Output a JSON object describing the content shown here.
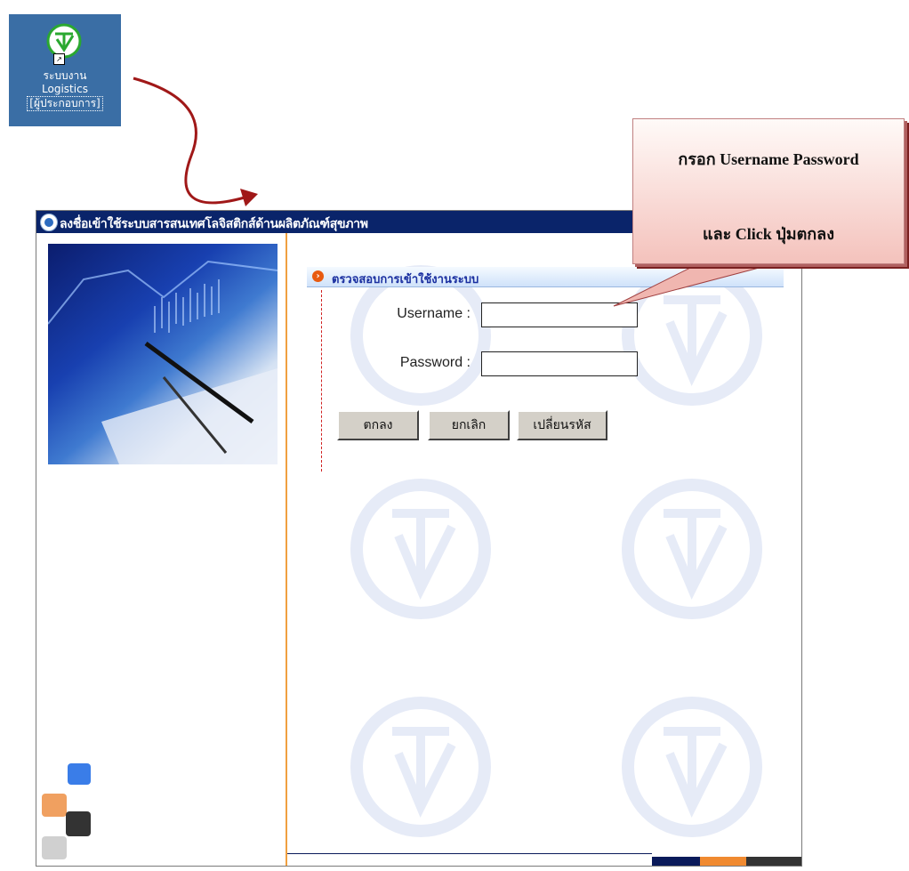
{
  "desktop_icon": {
    "label_lines": [
      "ระบบงาน",
      "Logistics",
      "[ผู้ประกอบการ]"
    ]
  },
  "window": {
    "title": "ลงชื่อเข้าใช้ระบบสารสนเทศโลจิสติกส์ด้านผลิตภัณฑ์สุขภาพ",
    "section_header": "ตรวจสอบการเข้าใช้งานระบบ",
    "username_label": "Username :",
    "username_value": "",
    "password_label": "Password :",
    "password_value": "",
    "buttons": {
      "ok": "ตกลง",
      "cancel": "ยกเลิก",
      "change_password": "เปลี่ยนรหัส"
    }
  },
  "callout": {
    "line1": "กรอก Username Password",
    "line2": "และ Click ปุ่มตกลง"
  },
  "colors": {
    "titlebar": "#0a246a",
    "desktop": "#3a6ea5",
    "accent_orange": "#f0a040",
    "arrow": "#a01818",
    "callout_fill": "#f4c2bc",
    "section_text": "#1a2fa0"
  },
  "icons": {
    "app_icon": "fda-logo-icon",
    "shortcut_overlay": "shortcut-arrow-icon",
    "window_icon": "globe-icon",
    "section_bullet": "arrow-circle-icon"
  }
}
